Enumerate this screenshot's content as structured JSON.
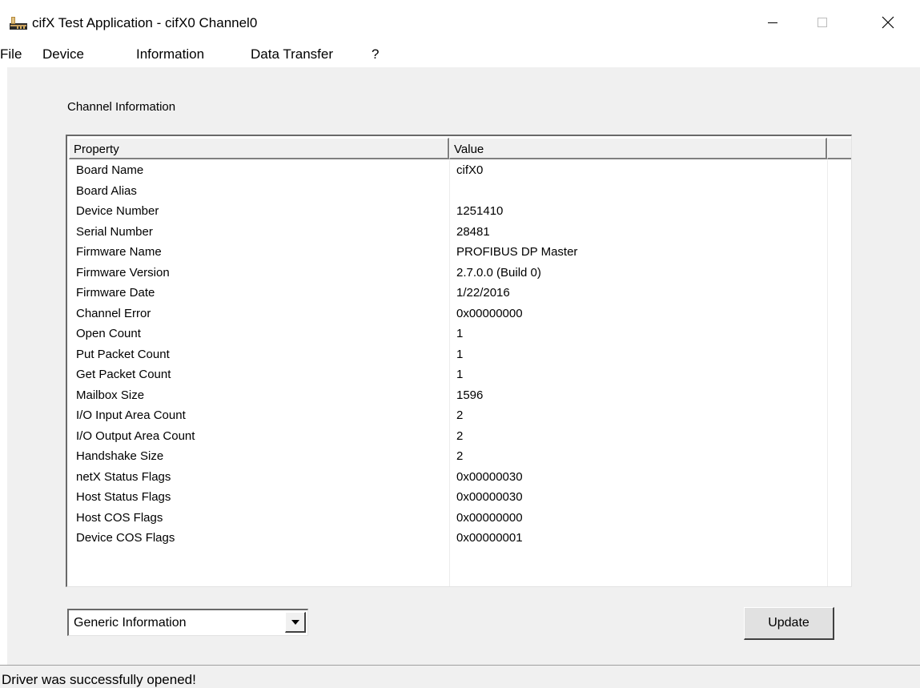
{
  "window": {
    "title": "cifX Test Application - cifX0 Channel0",
    "icons": {
      "app": "app-icon",
      "minimize": "minimize-icon",
      "maximize": "maximize-icon",
      "close": "close-icon"
    }
  },
  "menu": [
    {
      "label": "File"
    },
    {
      "label": "Device"
    },
    {
      "label": "Information"
    },
    {
      "label": "Data Transfer"
    },
    {
      "label": "?"
    }
  ],
  "group_label": "Channel Information",
  "table": {
    "columns": [
      "Property",
      "Value",
      ""
    ],
    "rows": [
      {
        "property": "Board Name",
        "value": "cifX0"
      },
      {
        "property": "Board Alias",
        "value": ""
      },
      {
        "property": "Device Number",
        "value": "1251410"
      },
      {
        "property": "Serial Number",
        "value": "28481"
      },
      {
        "property": "Firmware Name",
        "value": "PROFIBUS DP Master"
      },
      {
        "property": "Firmware Version",
        "value": "2.7.0.0 (Build 0)"
      },
      {
        "property": "Firmware Date",
        "value": "1/22/2016"
      },
      {
        "property": "Channel Error",
        "value": "0x00000000"
      },
      {
        "property": "Open Count",
        "value": "1"
      },
      {
        "property": "Put Packet Count",
        "value": "1"
      },
      {
        "property": "Get Packet Count",
        "value": "1"
      },
      {
        "property": "Mailbox Size",
        "value": "1596"
      },
      {
        "property": "I/O Input Area Count",
        "value": "2"
      },
      {
        "property": "I/O Output Area Count",
        "value": "2"
      },
      {
        "property": "Handshake Size",
        "value": "2"
      },
      {
        "property": "netX Status Flags",
        "value": "0x00000030"
      },
      {
        "property": "Host Status Flags",
        "value": "0x00000030"
      },
      {
        "property": "Host COS Flags",
        "value": "0x00000000"
      },
      {
        "property": "Device COS Flags",
        "value": "0x00000001"
      },
      {
        "property": "",
        "value": ""
      }
    ]
  },
  "combo": {
    "selected": "Generic Information",
    "icon": "dropdown-arrow-icon"
  },
  "update_button": "Update",
  "status_text": "Driver was successfully opened!"
}
